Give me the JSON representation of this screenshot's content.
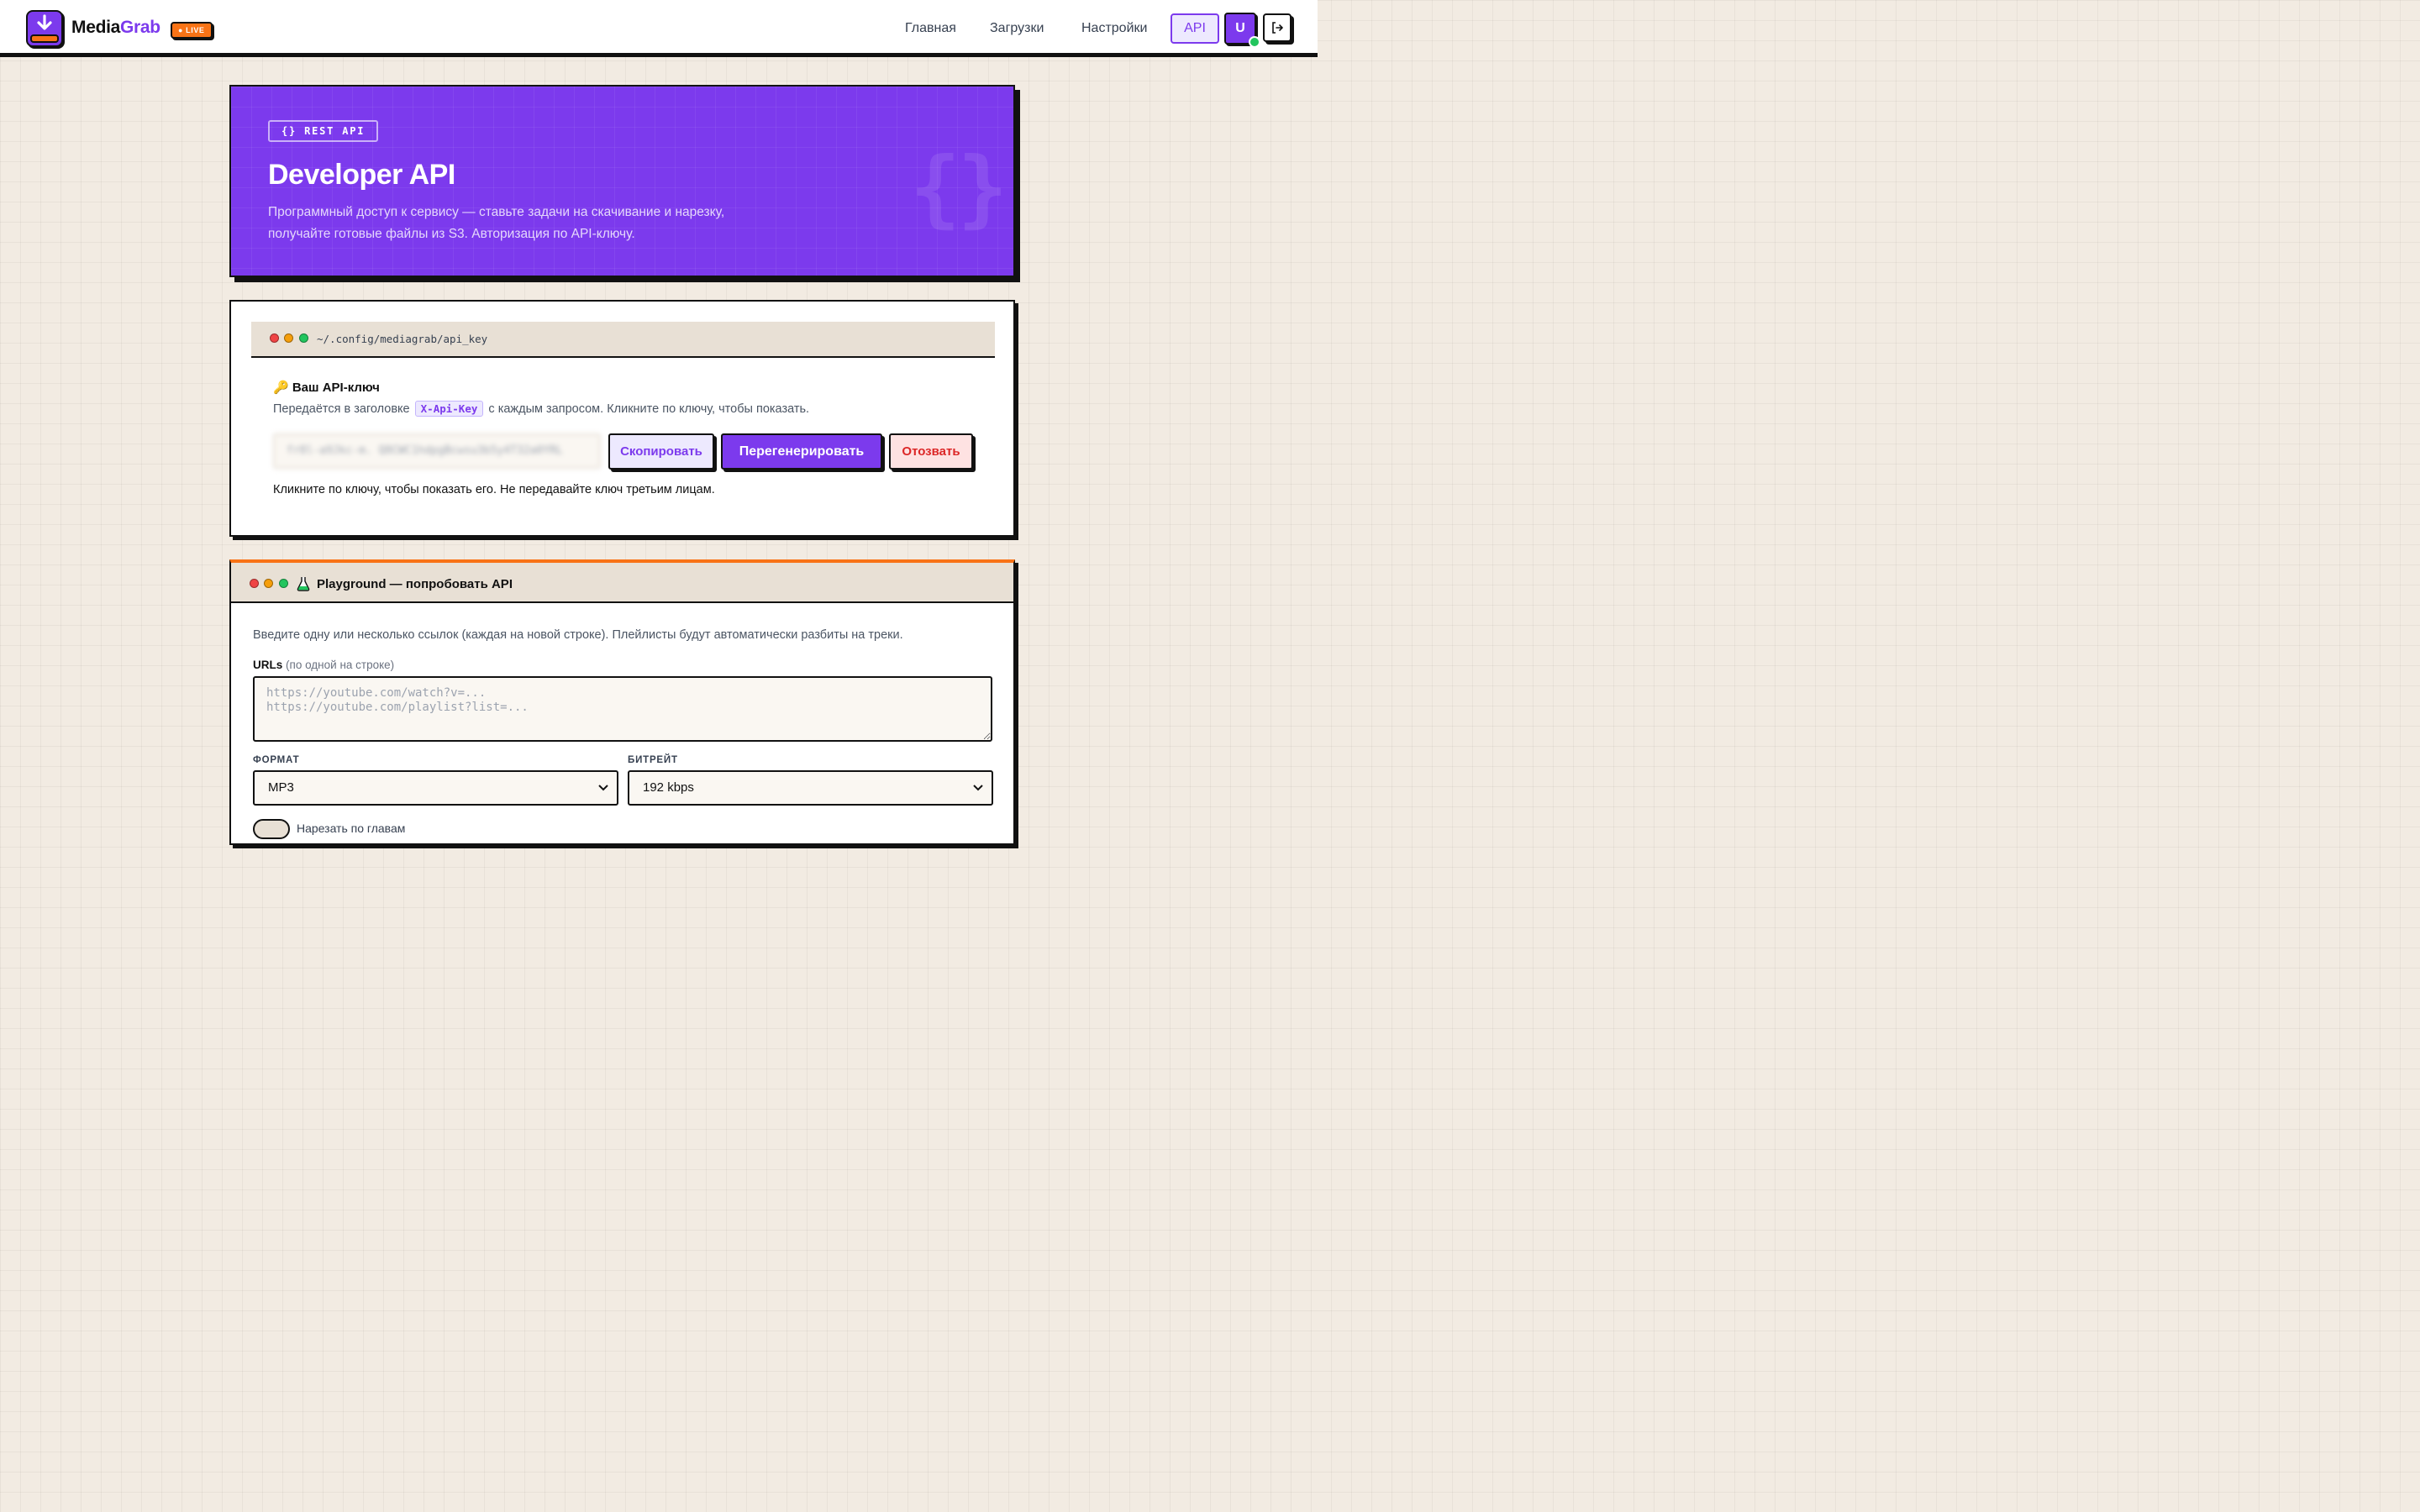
{
  "header": {
    "brand_part1": "Media",
    "brand_part2": "Grab",
    "live_badge": "● LIVE",
    "nav": [
      "Главная",
      "Загрузки",
      "Настройки"
    ],
    "api_button": "API",
    "avatar_letter": "U"
  },
  "hero": {
    "badge": "{} REST API",
    "title": "Developer API",
    "description_line1": "Программный доступ к сервису — ставьте задачи на скачивание и нарезку,",
    "description_line2": "получайте готовые файлы из S3. Авторизация по API-ключу.",
    "decor": "{}"
  },
  "api_key": {
    "path": "~/.config/mediagrab/api_key",
    "title": "🔑 Ваш API-ключ",
    "desc_before": "Передаётся в заголовке",
    "header_name": "X-Api-Key",
    "desc_after": "с каждым запросом. Кликните по ключу, чтобы показать.",
    "masked_key": "fr8l-a9Jkc-m. Q8CWC1hdpgBcwsu3b5y4T32a0YRL",
    "copy_button": "Скопировать",
    "regen_button": "Перегенерировать",
    "revoke_button": "Отозвать",
    "note": "Кликните по ключу, чтобы показать его. Не передавайте ключ третьим лицам."
  },
  "playground": {
    "title": "Playground — попробовать API",
    "description": "Введите одну или несколько ссылок (каждая на новой строке). Плейлисты будут автоматически разбиты на треки.",
    "urls_label": "URLs",
    "urls_hint": "(по одной на строке)",
    "urls_placeholder": "https://youtube.com/watch?v=...\nhttps://youtube.com/playlist?list=...",
    "format_label": "ФОРМАТ",
    "format_value": "MP3",
    "bitrate_label": "БИТРЕЙТ",
    "bitrate_value": "192 kbps",
    "toggle_label": "Нарезать по главам"
  },
  "colors": {
    "accent": "#7c3aed",
    "orange": "#f97316",
    "danger": "#dc2626",
    "background": "#f2ebe2"
  }
}
